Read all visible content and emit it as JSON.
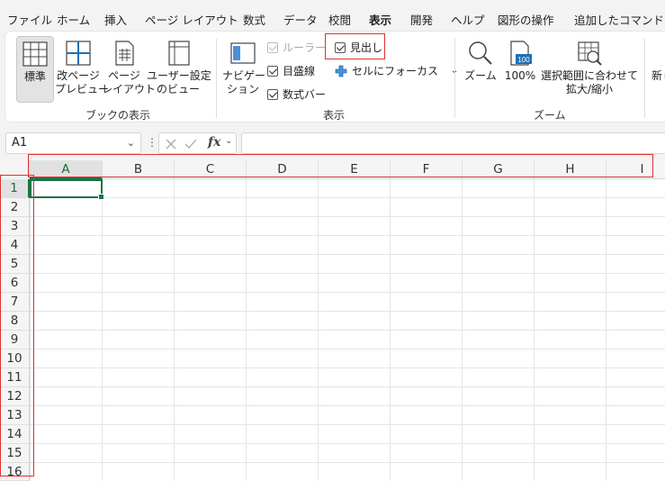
{
  "menu": {
    "tabs": [
      "ファイル",
      "ホーム",
      "挿入",
      "ページ レイアウト",
      "数式",
      "データ",
      "校閲",
      "表示",
      "開発",
      "ヘルプ",
      "図形の操作",
      "追加したコマンド"
    ],
    "active_tab": "表示"
  },
  "ribbon": {
    "workbook_views": {
      "label": "ブックの表示",
      "normal": "標準",
      "page_break": "改ページ\nプレビュー",
      "page_layout": "ページ\nレイアウト",
      "custom": "ユーザー設定\nのビュー"
    },
    "show": {
      "label": "表示",
      "navigation": "ナビゲー\nション",
      "ruler": "ルーラー",
      "gridlines": "目盛線",
      "formula_bar": "数式バー",
      "headings": "見出し",
      "focus_cell": "セルにフォーカス"
    },
    "zoom": {
      "label": "ズーム",
      "zoom": "ズーム",
      "hundred": "100%",
      "hundred_icon_text": "100",
      "fit_selection": "選択範囲に合わせて\n拡大/縮小"
    },
    "window": {
      "new": "新し"
    }
  },
  "formula_bar": {
    "name_box": "A1",
    "fx": "fx",
    "formula": ""
  },
  "grid": {
    "columns": [
      "A",
      "B",
      "C",
      "D",
      "E",
      "F",
      "G",
      "H",
      "I"
    ],
    "rows": [
      "1",
      "2",
      "3",
      "4",
      "5",
      "6",
      "7",
      "8",
      "9",
      "10",
      "11",
      "12",
      "13",
      "14",
      "15",
      "16"
    ],
    "active_cell": "A1"
  },
  "colors": {
    "accent": "#1e7145",
    "highlight": "#e03030"
  }
}
